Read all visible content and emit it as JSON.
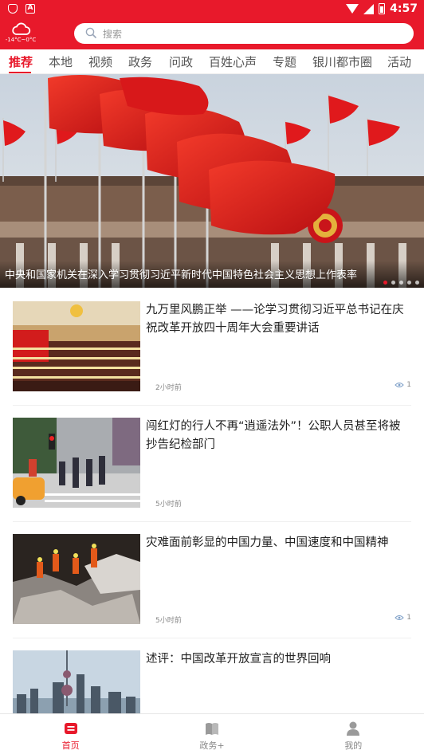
{
  "status_bar": {
    "time": "4:57"
  },
  "header": {
    "weather_icon": "cloud-icon",
    "temperature": "-14°C~0°C",
    "search_placeholder": "搜索"
  },
  "tabs": [
    {
      "label": "推荐",
      "active": true
    },
    {
      "label": "本地"
    },
    {
      "label": "视频"
    },
    {
      "label": "政务"
    },
    {
      "label": "问政"
    },
    {
      "label": "百姓心声"
    },
    {
      "label": "专题"
    },
    {
      "label": "银川都市圈"
    },
    {
      "label": "活动"
    }
  ],
  "hero": {
    "caption": "中央和国家机关在深入学习贯彻习近平新时代中国特色社会主义思想上作表率"
  },
  "news": [
    {
      "title": "九万里风鹏正举 ——论学习贯彻习近平总书记在庆祝改革开放四十周年大会重要讲话",
      "time": "2小时前",
      "views": "1"
    },
    {
      "title": "闯红灯的行人不再“逍遥法外”！公职人员甚至将被抄告纪检部门",
      "time": "5小时前",
      "views": ""
    },
    {
      "title": "灾难面前彰显的中国力量、中国速度和中国精神",
      "time": "5小时前",
      "views": "1"
    },
    {
      "title": "述评：中国改革开放宣言的世界回响",
      "time": "",
      "views": ""
    }
  ],
  "bottom_nav": [
    {
      "label": "首页",
      "icon": "home-icon",
      "active": true
    },
    {
      "label": "政务+",
      "icon": "book-icon"
    },
    {
      "label": "我的",
      "icon": "user-icon"
    }
  ],
  "colors": {
    "brand": "#e8192b"
  }
}
